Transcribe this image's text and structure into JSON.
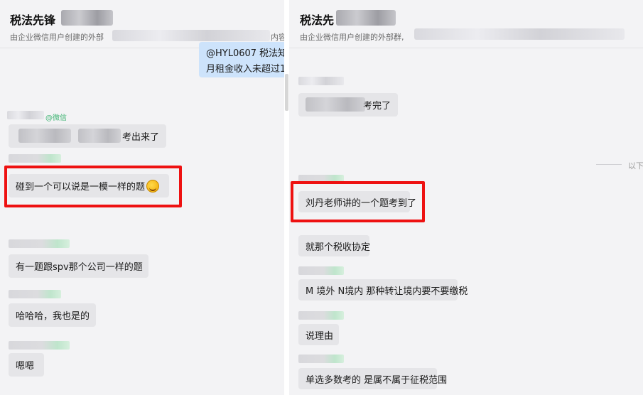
{
  "left_chat": {
    "title": "税法先锋",
    "subtitle": "由企业微信用户创建的外部",
    "subtitle_tail": "内容",
    "my_message_lines": [
      "@HYL0607  税法知",
      "月租金收入未超过1"
    ],
    "tag_label": "@微信",
    "messages": [
      {
        "text": "考出来了"
      },
      {
        "text": "碰到一个可以说是一模一样的题"
      },
      {
        "text": "有一题跟spv那个公司一样的题"
      },
      {
        "text": "哈哈哈，我也是的"
      },
      {
        "text": "嗯嗯"
      }
    ],
    "emoji_icon": "laughing-tears-emoji-icon"
  },
  "right_chat": {
    "title": "税法先",
    "subtitle": "由企业微信用户创建的外部群,",
    "divider_label": "以下",
    "messages": [
      {
        "text": "考完了"
      },
      {
        "text": "刘丹老师讲的一个题考到了"
      },
      {
        "text": "就那个税收协定"
      },
      {
        "text": "M 境外 N境内 那种转让境内要不要缴税"
      },
      {
        "text": "说理由"
      },
      {
        "text": "单选多数考的 是属不属于征税范围"
      }
    ]
  },
  "colors": {
    "background": "#f3f3f5",
    "bubble": "#e5e5e8",
    "my_bubble": "#cde3fb",
    "highlight": "#ee1111",
    "divider_gutter": "#ffffff"
  }
}
